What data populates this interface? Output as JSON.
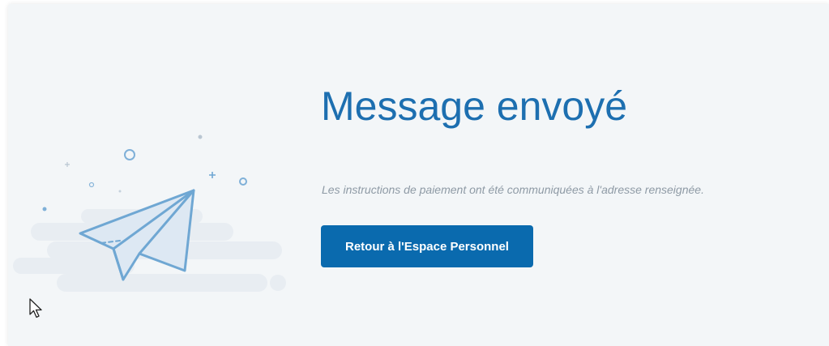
{
  "confirmation": {
    "title": "Message envoyé",
    "message": "Les instructions de paiement ont été communiquées à l'adresse renseignée.",
    "button_label": "Retour à l'Espace Personnel"
  },
  "illustration": {
    "icon": "paper-plane-icon"
  },
  "colors": {
    "title": "#1d6fb0",
    "button": "#0a6aae",
    "background": "#f3f6f8",
    "plane_stroke": "#6fa7d3"
  }
}
